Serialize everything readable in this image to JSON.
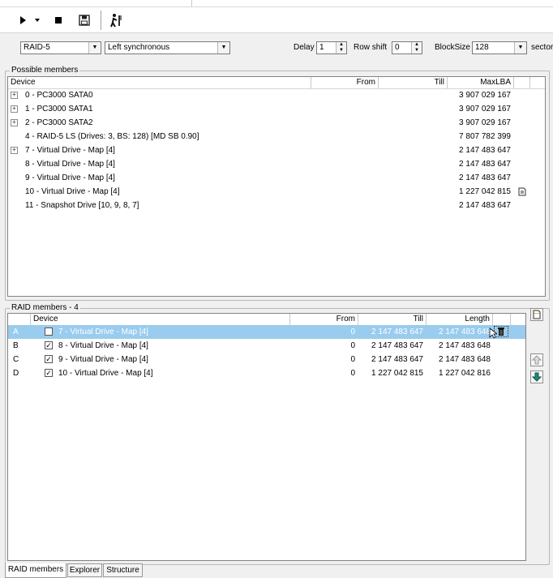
{
  "toolbar": {
    "buttons": [
      "play-icon",
      "dropdown-arrow-icon",
      "stop-icon",
      "save-icon",
      "walk-icon"
    ]
  },
  "params": {
    "raid_type": "RAID-5",
    "layout": "Left synchronous",
    "delay_label": "Delay",
    "delay_value": "1",
    "row_shift_label": "Row shift",
    "row_shift_value": "0",
    "block_size_label": "BlockSize",
    "block_size_value": "128",
    "block_unit_label": "sector"
  },
  "possible_members": {
    "title": "Possible members",
    "columns": [
      "Device",
      "From",
      "Till",
      "MaxLBA"
    ],
    "rows": [
      {
        "device": "0 - PC3000 SATA0",
        "maxlba": "3 907 029 167",
        "expandable": true
      },
      {
        "device": "1 - PC3000 SATA1",
        "maxlba": "3 907 029 167",
        "expandable": true
      },
      {
        "device": "2 - PC3000 SATA2",
        "maxlba": "3 907 029 167",
        "expandable": true
      },
      {
        "device": "4 - RAID-5 LS (Drives: 3, BS: 128) [MD SB 0.90]",
        "maxlba": "7 807 782 399",
        "expandable": false
      },
      {
        "device": "7 - Virtual Drive - Map [4]",
        "maxlba": "2 147 483 647",
        "expandable": true
      },
      {
        "device": "8 - Virtual Drive - Map [4]",
        "maxlba": "2 147 483 647",
        "expandable": false
      },
      {
        "device": "9 - Virtual Drive - Map [4]",
        "maxlba": "2 147 483 647",
        "expandable": false
      },
      {
        "device": "10 - Virtual Drive - Map [4]",
        "maxlba": "1 227 042 815",
        "expandable": false,
        "doc_icon": true
      },
      {
        "device": "11 - Snapshot Drive [10, 9, 8, 7]",
        "maxlba": "2 147 483 647",
        "expandable": false
      }
    ]
  },
  "raid_members": {
    "title": "RAID members - 4",
    "columns": [
      "Device",
      "From",
      "Till",
      "Length"
    ],
    "rows": [
      {
        "letter": "A",
        "checked": true,
        "device": "7 - Virtual Drive - Map [4]",
        "from": "0",
        "till": "2 147 483 647",
        "length": "2 147 483 648",
        "selected": true
      },
      {
        "letter": "B",
        "checked": true,
        "device": "8 - Virtual Drive - Map [4]",
        "from": "0",
        "till": "2 147 483 647",
        "length": "2 147 483 648",
        "selected": false
      },
      {
        "letter": "C",
        "checked": true,
        "device": "9 - Virtual Drive - Map [4]",
        "from": "0",
        "till": "2 147 483 647",
        "length": "2 147 483 648",
        "selected": false
      },
      {
        "letter": "D",
        "checked": true,
        "device": "10 - Virtual Drive - Map [4]",
        "from": "0",
        "till": "1 227 042 815",
        "length": "1 227 042 816",
        "selected": false
      }
    ]
  },
  "tabs": [
    {
      "label": "RAID members",
      "active": true
    },
    {
      "label": "Explorer",
      "active": false
    },
    {
      "label": "Structure",
      "active": false
    }
  ],
  "colors": {
    "selection": "#99ccee",
    "window_bg": "#f0f0f0",
    "move_down_arrow": "#1e8a72"
  }
}
